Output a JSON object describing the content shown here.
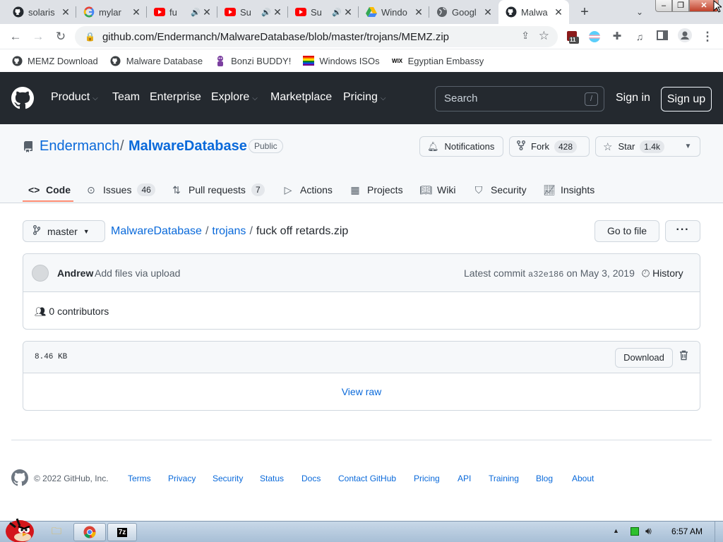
{
  "browser": {
    "tabs": [
      {
        "title": "solaris",
        "icon": "github-icon",
        "audio": false,
        "active": false
      },
      {
        "title": "mylar",
        "icon": "google-icon",
        "audio": false,
        "active": false
      },
      {
        "title": "fu",
        "icon": "youtube-icon",
        "audio": true,
        "active": false
      },
      {
        "title": "Su",
        "icon": "youtube-icon",
        "audio": true,
        "active": false
      },
      {
        "title": "Su",
        "icon": "youtube-icon",
        "audio": true,
        "active": false
      },
      {
        "title": "Windo",
        "icon": "google-drive-icon",
        "audio": false,
        "active": false
      },
      {
        "title": "Googl",
        "icon": "globe-icon",
        "audio": false,
        "active": false
      },
      {
        "title": "Malwa",
        "icon": "github-icon",
        "audio": false,
        "active": true
      }
    ],
    "tab_close_glyph": "✕",
    "new_tab_glyph": "+",
    "tab_search_glyph": "⌄",
    "window_controls": {
      "minimize": "–",
      "maximize": "❐",
      "close": "✕"
    },
    "url": "github.com/Endermanch/MalwareDatabase/blob/master/trojans/MEMZ.zip",
    "extension_badge": "11",
    "bookmarks": [
      {
        "label": "MEMZ Download",
        "icon": "github-icon"
      },
      {
        "label": "Malware Database",
        "icon": "github-icon"
      },
      {
        "label": "Bonzi BUDDY!",
        "icon": "bonzi-icon"
      },
      {
        "label": "Windows ISOs",
        "icon": "rainbow-flag-icon"
      },
      {
        "label": "Egyptian Embassy",
        "icon": "wix-icon"
      }
    ]
  },
  "github_header": {
    "nav": [
      "Product",
      "Team",
      "Enterprise",
      "Explore",
      "Marketplace",
      "Pricing"
    ],
    "nav_has_dropdown": [
      true,
      false,
      false,
      true,
      false,
      true
    ],
    "search_placeholder": "Search",
    "search_key": "/",
    "sign_in": "Sign in",
    "sign_up": "Sign up"
  },
  "repo": {
    "owner": "Endermanch",
    "separator": "/",
    "name": "MalwareDatabase",
    "visibility": "Public",
    "notifications_label": "Notifications",
    "fork_label": "Fork",
    "fork_count": "428",
    "star_label": "Star",
    "star_count": "1.4k",
    "tabs": [
      {
        "label": "Code",
        "icon": "code-icon",
        "count": ""
      },
      {
        "label": "Issues",
        "icon": "issue-icon",
        "count": "46"
      },
      {
        "label": "Pull requests",
        "icon": "pull-request-icon",
        "count": "7"
      },
      {
        "label": "Actions",
        "icon": "play-icon",
        "count": ""
      },
      {
        "label": "Projects",
        "icon": "table-icon",
        "count": ""
      },
      {
        "label": "Wiki",
        "icon": "book-icon",
        "count": ""
      },
      {
        "label": "Security",
        "icon": "shield-icon",
        "count": ""
      },
      {
        "label": "Insights",
        "icon": "graph-icon",
        "count": ""
      }
    ]
  },
  "file_nav": {
    "branch": "master",
    "breadcrumb": [
      "MalwareDatabase",
      "trojans"
    ],
    "file_name": "fuck off retards.zip",
    "goto_file": "Go to file",
    "more": "···"
  },
  "commit": {
    "author": "Andrew",
    "message": "Add files via upload",
    "latest_label": "Latest commit",
    "sha": "a32e186",
    "date": "on May 3, 2019",
    "history": "History",
    "contributors": "0 contributors"
  },
  "file": {
    "size": "8.46 KB",
    "download": "Download",
    "view_raw": "View raw"
  },
  "footer": {
    "copyright": "© 2022 GitHub, Inc.",
    "links": [
      "Terms",
      "Privacy",
      "Security",
      "Status",
      "Docs",
      "Contact GitHub",
      "Pricing",
      "API",
      "Training",
      "Blog",
      "About"
    ]
  },
  "taskbar": {
    "clock": "6:57 AM"
  },
  "colors": {
    "header_bg": "#24292f",
    "link": "#0969da",
    "tab_underline": "#fd8c73",
    "taskbar": "#b8cce0"
  }
}
